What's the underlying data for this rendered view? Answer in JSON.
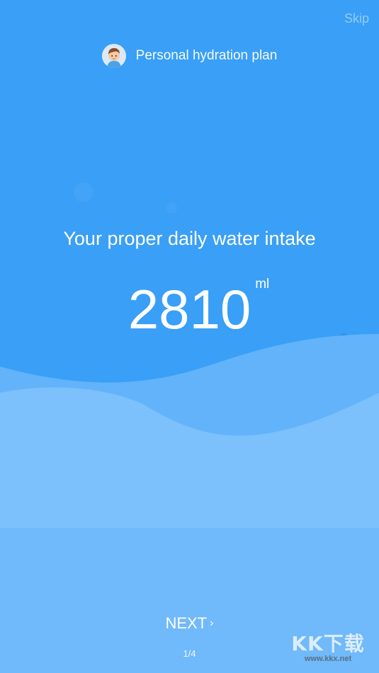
{
  "skip_label": "Skip",
  "header": {
    "title": "Personal hydration plan",
    "avatar_icon": "boy-avatar"
  },
  "intake": {
    "headline": "Your proper daily water intake",
    "value": "2810",
    "unit": "ml"
  },
  "footer": {
    "next_label": "NEXT",
    "next_icon": "chevron-right-icon",
    "pager": "1/4"
  },
  "watermark": {
    "logo": "KK下载",
    "url": "www.kkx.net"
  },
  "colors": {
    "background": "#3a9ff6",
    "wave_light": "#6cb8fb",
    "wave_lighter": "#7cc0fc",
    "text": "#ffffff"
  }
}
